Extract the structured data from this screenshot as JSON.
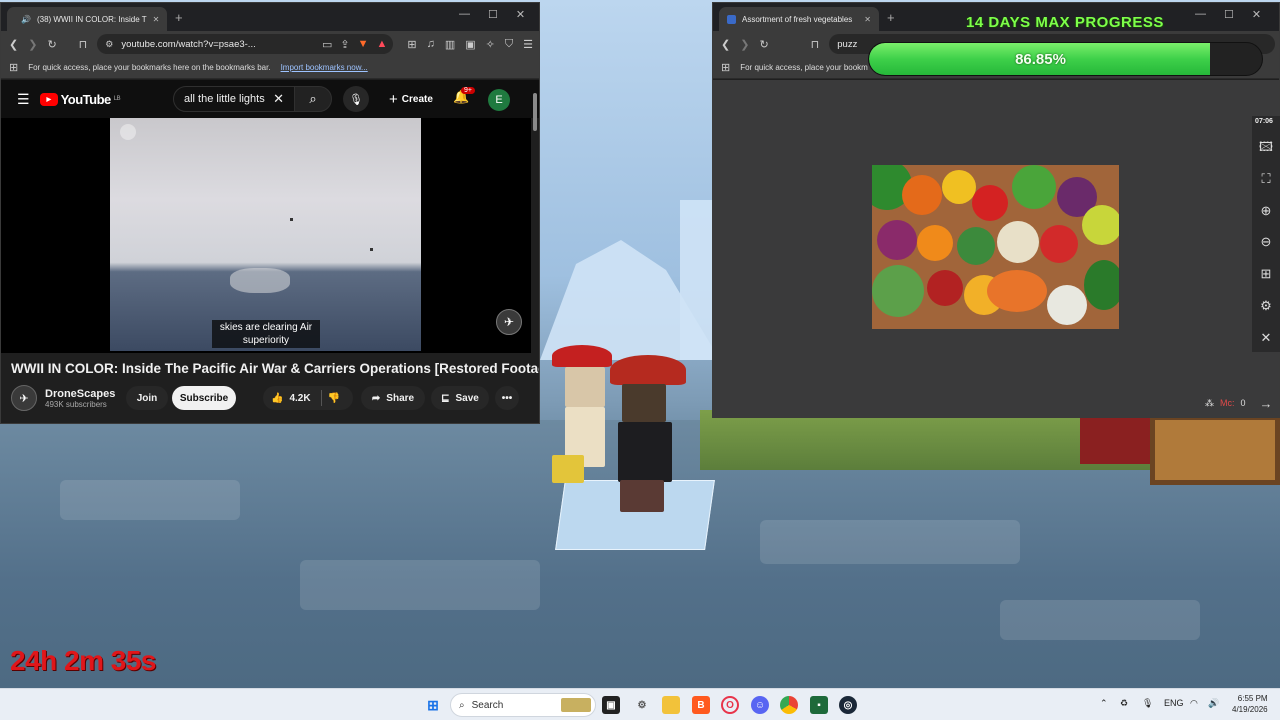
{
  "youtube_window": {
    "tab_title": "(38) WWII IN COLOR: Inside T",
    "url": "youtube.com/watch?v=psae3-...",
    "bookmarks_text": "For quick access, place your bookmarks here on the bookmarks bar.",
    "bookmarks_link": "Import bookmarks now...",
    "logo_text": "YouTube",
    "logo_sup": "LB",
    "search_value": "all the little lights",
    "create_label": "Create",
    "notif_count": "9+",
    "avatar_letter": "E",
    "caption": "skies are clearing Air superiority",
    "video_title": "WWII IN COLOR: Inside The Pacific Air War & Carriers Operations [Restored Footage]",
    "channel_name": "DroneScapes",
    "channel_subs": "493K subscribers",
    "join_label": "Join",
    "subscribe_label": "Subscribe",
    "like_count": "4.2K",
    "share_label": "Share",
    "save_label": "Save"
  },
  "puzzle_window": {
    "tab_title": "Assortment of fresh vegetables",
    "url": "puzz",
    "bookmarks_text": "For quick access, place your bookm",
    "timer": "07:06",
    "moves_label": "Mc:",
    "moves_value": "0"
  },
  "overlay": {
    "progress_title": "14 DAYS MAX PROGRESS",
    "progress_text": "86.85%",
    "progress_value": 0.8685,
    "run_timer": "24h 2m 35s"
  },
  "taskbar": {
    "search_placeholder": "Search",
    "language": "ENG",
    "time": "6:55 PM",
    "date": "4/19/2026"
  },
  "colors": {
    "youtube_red": "#ff0000",
    "progress_green": "#3ed04a",
    "timer_red": "#e0161a"
  }
}
